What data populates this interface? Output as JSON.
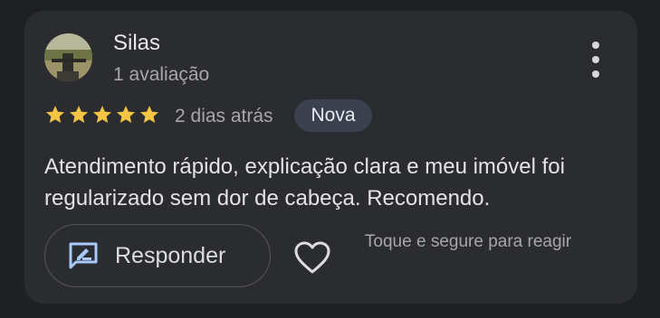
{
  "review": {
    "author_name": "Silas",
    "author_review_count": "1 avaliação",
    "rating": 5,
    "rating_max": 5,
    "date": "2 dias atrás",
    "badge": "Nova",
    "text": "Atendimento rápido, explicação clara e meu imóvel foi regularizado sem dor de cabeça. Recomendo."
  },
  "actions": {
    "respond_label": "Responder",
    "hint": "Toque e segure para reagir"
  },
  "icons": {
    "menu": "more-vert-icon",
    "respond": "reply-edit-icon",
    "react": "heart-outline-icon"
  },
  "colors": {
    "background": "#1f2023",
    "card": "#2b2c2f",
    "star": "#f6c343",
    "badge_bg": "#3c4150",
    "respond_icon": "#a8c7fa"
  }
}
